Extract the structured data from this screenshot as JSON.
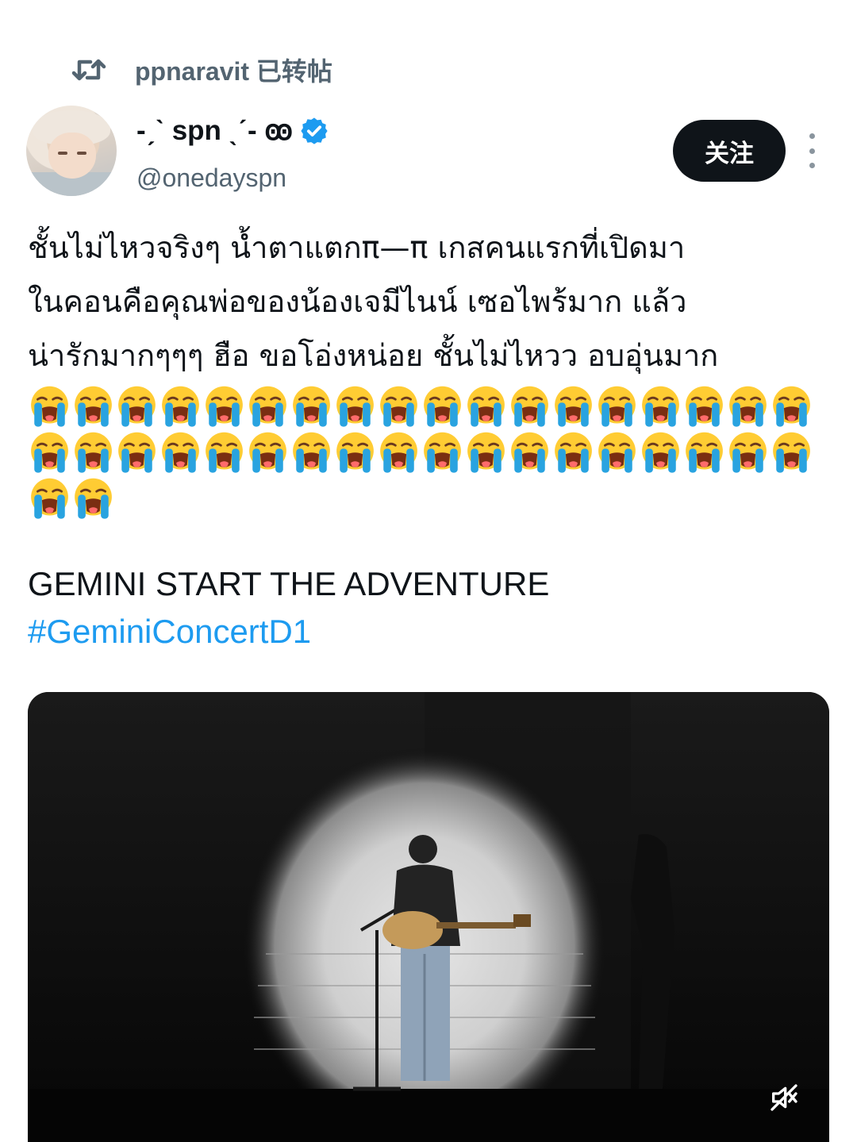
{
  "repost": {
    "icon": "repost-icon",
    "text": "ppnaravit 已转帖"
  },
  "author": {
    "display_name": "-ˏˋ spn ˎˊ- ꙭ",
    "handle": "@onedayspn",
    "verified": true,
    "avatar": "avatar"
  },
  "actions": {
    "follow_label": "关注",
    "more_icon": "more-vertical-icon"
  },
  "tweet": {
    "lines": [
      "ชั้นไม่ไหวจริงๆ น้ำตาแตกπ—π เกสคนแรกที่เปิดมา",
      "ในคอนคือคุณพ่อของน้องเจมีไนน์ เซอไพร้มาก แล้ว",
      "น่ารักมากๆๆๆ ฮือ ขอโอ่งหน่อย ชั้นไม่ไหวว อบอุ่นมาก"
    ],
    "emoji_name": "loudly-crying-face",
    "emoji_count": 38,
    "title": "GEMINI START THE ADVENTURE",
    "hashtag": "#GeminiConcertD1"
  },
  "media": {
    "type": "video",
    "muted": true,
    "mute_icon": "muted-speaker-icon"
  },
  "colors": {
    "text": "#0f1419",
    "secondary": "#536471",
    "accent": "#1d9bf0",
    "verified": "#1d9bf0",
    "button_bg": "#0f1419"
  }
}
